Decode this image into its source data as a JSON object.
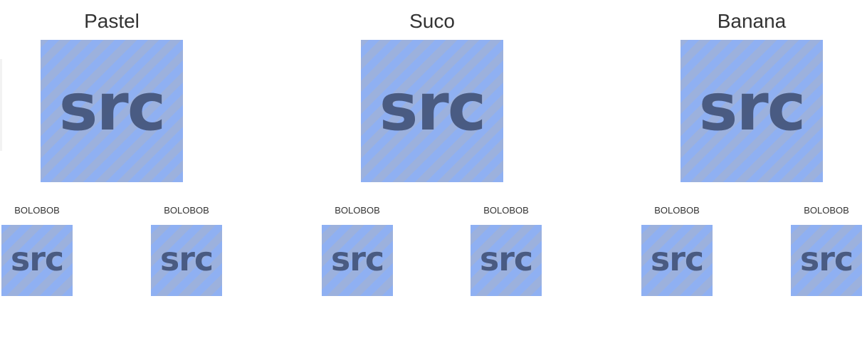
{
  "columns": [
    {
      "title": "Pastel",
      "image_text": "src",
      "items": [
        {
          "label": "BOLOBOB",
          "image_text": "src"
        },
        {
          "label": "BOLOBOB",
          "image_text": "src"
        }
      ]
    },
    {
      "title": "Suco",
      "image_text": "src",
      "items": [
        {
          "label": "BOLOBOB",
          "image_text": "src"
        },
        {
          "label": "BOLOBOB",
          "image_text": "src"
        }
      ]
    },
    {
      "title": "Banana",
      "image_text": "src",
      "items": [
        {
          "label": "BOLOBOB",
          "image_text": "src"
        },
        {
          "label": "BOLOBOB",
          "image_text": "src"
        }
      ]
    }
  ],
  "colors": {
    "placeholder_stripe_a": "#8fb0f2",
    "placeholder_stripe_b": "#9cb1dd",
    "placeholder_text": "#44547a",
    "text": "#333333"
  }
}
